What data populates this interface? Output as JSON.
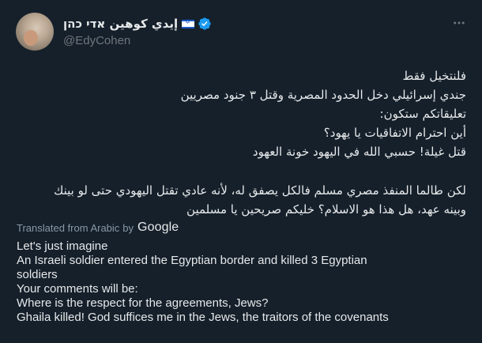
{
  "author": {
    "display_name": "إيدي كوهين אדי כהן",
    "handle": "@EdyCohen",
    "flag_icon": "israel-flag-icon",
    "verified_icon": "verified-badge-icon",
    "verified_color": "#1d9bf0"
  },
  "tweet": {
    "arabic_lines": [
      "فلنتخيل فقط",
      "جندي إسرائيلي دخل الحدود المصرية وقتل ٣ جنود مصريين",
      "تعليقاتكم ستكون:",
      "أين احترام الاتفاقيات يا يهود؟",
      "قتل غيلة! حسبي الله في اليهود خونة العهود",
      "",
      "لكن طالما المنفذ مصري مسلم فالكل يصفق له، لأنه عادي تقتل اليهودي حتى لو بينك",
      "وبينه عهد، هل هذا هو الاسلام؟ خليكم صريحين يا مسلمين"
    ],
    "translated_label": "Translated from Arabic",
    "by_label": "by",
    "google_label": "Google",
    "english_lines": [
      "Let's just imagine",
      "An Israeli soldier entered the Egyptian border and killed 3 Egyptian",
      "soldiers",
      "Your comments will be:",
      "Where is the respect for the agreements, Jews?",
      "Ghaila killed! God suffices me in the Jews, the traitors of the covenants"
    ]
  },
  "colors": {
    "background": "#15202b",
    "text": "#e7e9ea",
    "muted": "#71767b",
    "translated": "#8899a6"
  }
}
